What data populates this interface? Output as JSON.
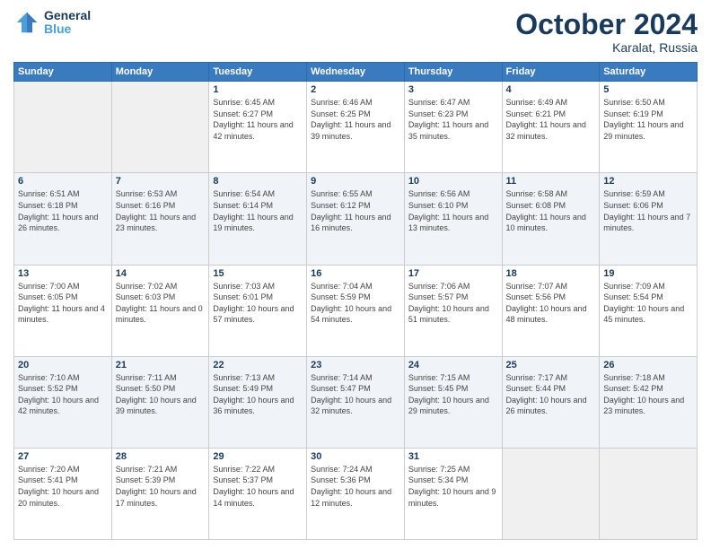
{
  "header": {
    "logo_general": "General",
    "logo_blue": "Blue",
    "month_title": "October 2024",
    "location": "Karalat, Russia"
  },
  "days_of_week": [
    "Sunday",
    "Monday",
    "Tuesday",
    "Wednesday",
    "Thursday",
    "Friday",
    "Saturday"
  ],
  "weeks": [
    [
      {
        "day": "",
        "info": ""
      },
      {
        "day": "",
        "info": ""
      },
      {
        "day": "1",
        "info": "Sunrise: 6:45 AM\nSunset: 6:27 PM\nDaylight: 11 hours and 42 minutes."
      },
      {
        "day": "2",
        "info": "Sunrise: 6:46 AM\nSunset: 6:25 PM\nDaylight: 11 hours and 39 minutes."
      },
      {
        "day": "3",
        "info": "Sunrise: 6:47 AM\nSunset: 6:23 PM\nDaylight: 11 hours and 35 minutes."
      },
      {
        "day": "4",
        "info": "Sunrise: 6:49 AM\nSunset: 6:21 PM\nDaylight: 11 hours and 32 minutes."
      },
      {
        "day": "5",
        "info": "Sunrise: 6:50 AM\nSunset: 6:19 PM\nDaylight: 11 hours and 29 minutes."
      }
    ],
    [
      {
        "day": "6",
        "info": "Sunrise: 6:51 AM\nSunset: 6:18 PM\nDaylight: 11 hours and 26 minutes."
      },
      {
        "day": "7",
        "info": "Sunrise: 6:53 AM\nSunset: 6:16 PM\nDaylight: 11 hours and 23 minutes."
      },
      {
        "day": "8",
        "info": "Sunrise: 6:54 AM\nSunset: 6:14 PM\nDaylight: 11 hours and 19 minutes."
      },
      {
        "day": "9",
        "info": "Sunrise: 6:55 AM\nSunset: 6:12 PM\nDaylight: 11 hours and 16 minutes."
      },
      {
        "day": "10",
        "info": "Sunrise: 6:56 AM\nSunset: 6:10 PM\nDaylight: 11 hours and 13 minutes."
      },
      {
        "day": "11",
        "info": "Sunrise: 6:58 AM\nSunset: 6:08 PM\nDaylight: 11 hours and 10 minutes."
      },
      {
        "day": "12",
        "info": "Sunrise: 6:59 AM\nSunset: 6:06 PM\nDaylight: 11 hours and 7 minutes."
      }
    ],
    [
      {
        "day": "13",
        "info": "Sunrise: 7:00 AM\nSunset: 6:05 PM\nDaylight: 11 hours and 4 minutes."
      },
      {
        "day": "14",
        "info": "Sunrise: 7:02 AM\nSunset: 6:03 PM\nDaylight: 11 hours and 0 minutes."
      },
      {
        "day": "15",
        "info": "Sunrise: 7:03 AM\nSunset: 6:01 PM\nDaylight: 10 hours and 57 minutes."
      },
      {
        "day": "16",
        "info": "Sunrise: 7:04 AM\nSunset: 5:59 PM\nDaylight: 10 hours and 54 minutes."
      },
      {
        "day": "17",
        "info": "Sunrise: 7:06 AM\nSunset: 5:57 PM\nDaylight: 10 hours and 51 minutes."
      },
      {
        "day": "18",
        "info": "Sunrise: 7:07 AM\nSunset: 5:56 PM\nDaylight: 10 hours and 48 minutes."
      },
      {
        "day": "19",
        "info": "Sunrise: 7:09 AM\nSunset: 5:54 PM\nDaylight: 10 hours and 45 minutes."
      }
    ],
    [
      {
        "day": "20",
        "info": "Sunrise: 7:10 AM\nSunset: 5:52 PM\nDaylight: 10 hours and 42 minutes."
      },
      {
        "day": "21",
        "info": "Sunrise: 7:11 AM\nSunset: 5:50 PM\nDaylight: 10 hours and 39 minutes."
      },
      {
        "day": "22",
        "info": "Sunrise: 7:13 AM\nSunset: 5:49 PM\nDaylight: 10 hours and 36 minutes."
      },
      {
        "day": "23",
        "info": "Sunrise: 7:14 AM\nSunset: 5:47 PM\nDaylight: 10 hours and 32 minutes."
      },
      {
        "day": "24",
        "info": "Sunrise: 7:15 AM\nSunset: 5:45 PM\nDaylight: 10 hours and 29 minutes."
      },
      {
        "day": "25",
        "info": "Sunrise: 7:17 AM\nSunset: 5:44 PM\nDaylight: 10 hours and 26 minutes."
      },
      {
        "day": "26",
        "info": "Sunrise: 7:18 AM\nSunset: 5:42 PM\nDaylight: 10 hours and 23 minutes."
      }
    ],
    [
      {
        "day": "27",
        "info": "Sunrise: 7:20 AM\nSunset: 5:41 PM\nDaylight: 10 hours and 20 minutes."
      },
      {
        "day": "28",
        "info": "Sunrise: 7:21 AM\nSunset: 5:39 PM\nDaylight: 10 hours and 17 minutes."
      },
      {
        "day": "29",
        "info": "Sunrise: 7:22 AM\nSunset: 5:37 PM\nDaylight: 10 hours and 14 minutes."
      },
      {
        "day": "30",
        "info": "Sunrise: 7:24 AM\nSunset: 5:36 PM\nDaylight: 10 hours and 12 minutes."
      },
      {
        "day": "31",
        "info": "Sunrise: 7:25 AM\nSunset: 5:34 PM\nDaylight: 10 hours and 9 minutes."
      },
      {
        "day": "",
        "info": ""
      },
      {
        "day": "",
        "info": ""
      }
    ]
  ]
}
